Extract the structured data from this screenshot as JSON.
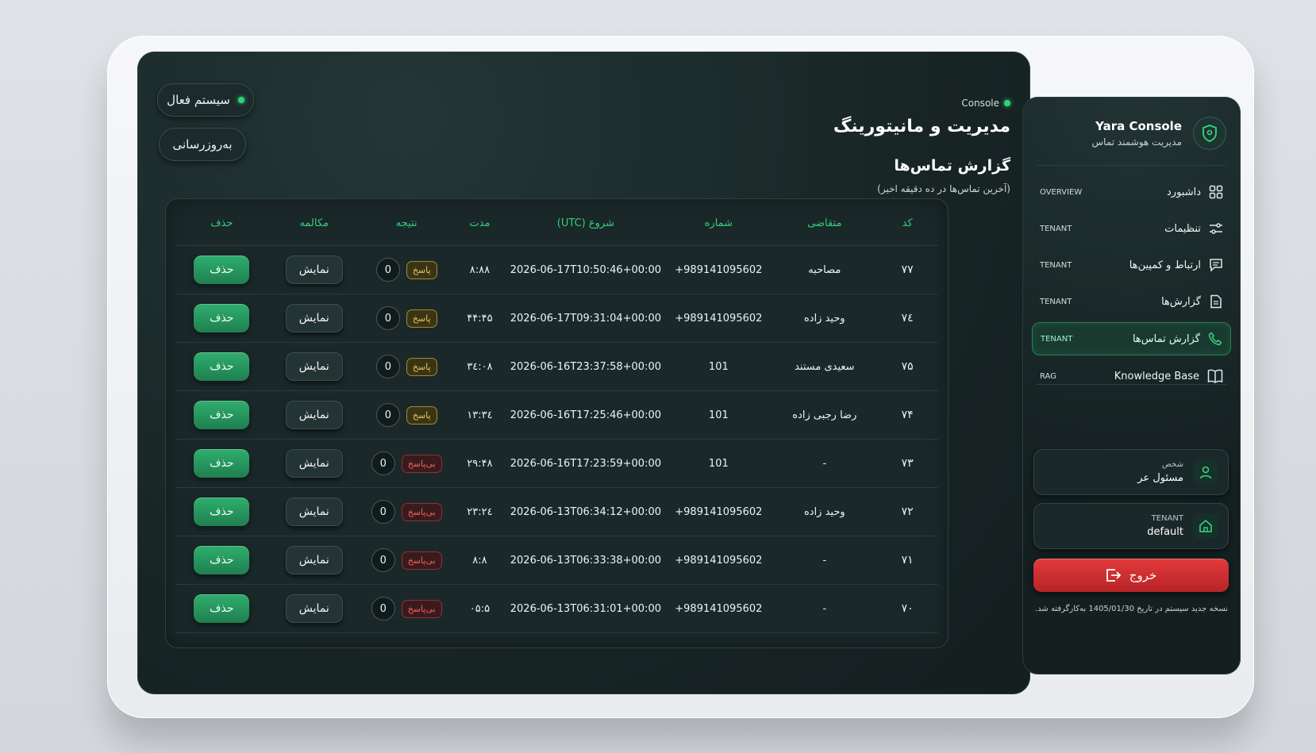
{
  "header": {
    "system_status": "سیستم فعال",
    "refresh_label": "به‌روزرسانی",
    "console_tag": "Console",
    "page_title": "مدیریت و مانیتورینگ",
    "section_title": "گزارش تماس‌ها",
    "section_subtitle": "(آخرین تماس‌ها در ده دقیقه اخیر)"
  },
  "table": {
    "columns": [
      "کد",
      "متقاضی",
      "شماره",
      "شروع (UTC)",
      "مدت",
      "نتیجه",
      "مکالمه",
      "حذف"
    ],
    "view_label": "نمایش",
    "delete_label": "حذف",
    "rows": [
      {
        "id": "۷۷",
        "requester": "مصاحبه",
        "number": "+989141095602",
        "start": "2026-06-17T10:50:46+00:00",
        "duration": "۸:۸۸",
        "result": "پاسخ",
        "status": "answered",
        "count": "0"
      },
      {
        "id": "۷٤",
        "requester": "وحید زاده",
        "number": "+989141095602",
        "start": "2026-06-17T09:31:04+00:00",
        "duration": "۴۴:۴۵",
        "result": "پاسخ",
        "status": "answered",
        "count": "0"
      },
      {
        "id": "۷۵",
        "requester": "سعیدی مستند",
        "number": "101",
        "start": "2026-06-16T23:37:58+00:00",
        "duration": "۳٤:٠۸",
        "result": "پاسخ",
        "status": "answered",
        "count": "0"
      },
      {
        "id": "۷۴",
        "requester": "رضا رجبی زاده",
        "number": "101",
        "start": "2026-06-16T17:25:46+00:00",
        "duration": "۱۳:۳٤",
        "result": "پاسخ",
        "status": "answered",
        "count": "0"
      },
      {
        "id": "۷۳",
        "requester": "-",
        "number": "101",
        "start": "2026-06-16T17:23:59+00:00",
        "duration": "۲۹:۴۸",
        "result": "بی‌پاسخ",
        "status": "unanswered",
        "count": "0"
      },
      {
        "id": "۷۲",
        "requester": "وحید زاده",
        "number": "+989141095602",
        "start": "2026-06-13T06:34:12+00:00",
        "duration": "۲۳:۲٤",
        "result": "بی‌پاسخ",
        "status": "unanswered",
        "count": "0"
      },
      {
        "id": "۷۱",
        "requester": "-",
        "number": "+989141095602",
        "start": "2026-06-13T06:33:38+00:00",
        "duration": "۸:۸",
        "result": "بی‌پاسخ",
        "status": "unanswered",
        "count": "0"
      },
      {
        "id": "۷٠",
        "requester": "-",
        "number": "+989141095602",
        "start": "2026-06-13T06:31:01+00:00",
        "duration": "۵:٠۵",
        "result": "بی‌پاسخ",
        "status": "unanswered",
        "count": "0"
      }
    ]
  },
  "sidebar": {
    "brand_name": "Yara Console",
    "brand_sub": "مدیریت هوشمند تماس",
    "items": [
      {
        "label": "داشبورد",
        "tag": "OVERVIEW",
        "icon": "grid-icon",
        "active": false
      },
      {
        "label": "تنظیمات",
        "tag": "TENANT",
        "icon": "sliders-icon",
        "active": false
      },
      {
        "label": "ارتباط و کمپین‌ها",
        "tag": "TENANT",
        "icon": "message-icon",
        "active": false
      },
      {
        "label": "گزارش‌ها",
        "tag": "TENANT",
        "icon": "document-icon",
        "active": false
      },
      {
        "label": "گزارش تماس‌ها",
        "tag": "TENANT",
        "icon": "phone-icon",
        "active": true
      },
      {
        "label": "Knowledge Base",
        "tag": "RAG",
        "icon": "book-icon",
        "active": false
      }
    ],
    "user_card": {
      "caption": "شخص",
      "value": "مسئول عر"
    },
    "tenant_card": {
      "caption": "TENANT",
      "value": "default"
    },
    "logout_label": "خروج",
    "footnote": "نسخه جدید سیستم در تاریخ 1405/01/30 به‌کارگرفته شد."
  },
  "colors": {
    "accent": "#2fd37a",
    "danger": "#d93034",
    "warning": "#e9c553",
    "background": "#182525"
  }
}
